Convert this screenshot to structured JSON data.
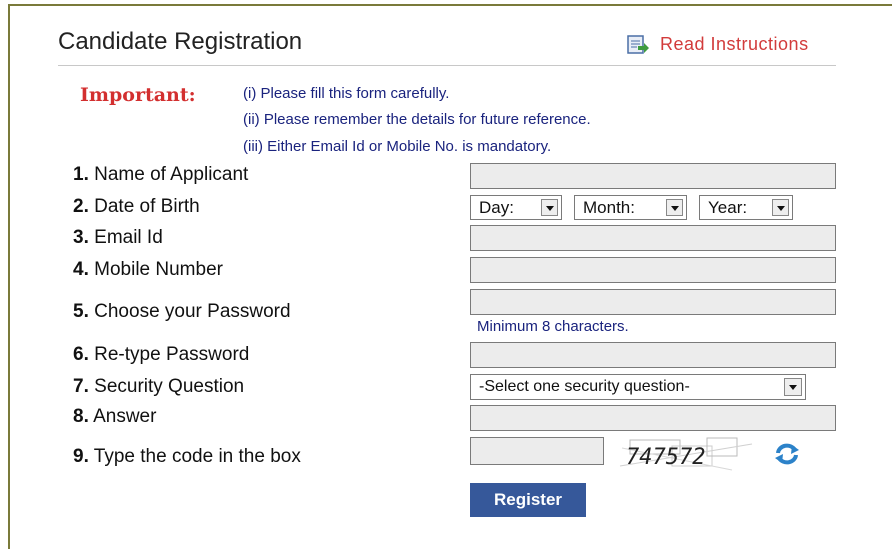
{
  "header": {
    "title": "Candidate Registration",
    "read_instructions": "Read Instructions"
  },
  "important": {
    "label": "Important:",
    "notes": [
      "(i) Please fill this form carefully.",
      "(ii) Please remember the details for future reference.",
      "(iii) Either Email Id or Mobile No. is mandatory."
    ]
  },
  "fields": [
    {
      "num": "1.",
      "label": "Name of Applicant"
    },
    {
      "num": "2.",
      "label": "Date of Birth"
    },
    {
      "num": "3.",
      "label": "Email Id"
    },
    {
      "num": "4.",
      "label": "Mobile Number"
    },
    {
      "num": "5.",
      "label": "Choose your Password"
    },
    {
      "num": "6.",
      "label": "Re-type Password"
    },
    {
      "num": "7.",
      "label": "Security Question"
    },
    {
      "num": "8.",
      "label": "Answer"
    },
    {
      "num": "9.",
      "label": "Type the code in the box"
    }
  ],
  "dob": {
    "day": "Day:",
    "month": "Month:",
    "year": "Year:"
  },
  "password_hint": "Minimum 8 characters.",
  "security_question": "-Select one security question-",
  "captcha_code": "747572",
  "register_label": "Register",
  "colors": {
    "important": "#d32f2f",
    "note": "#1a237e",
    "register_bg": "#36589a",
    "link": "#d23b3b"
  }
}
